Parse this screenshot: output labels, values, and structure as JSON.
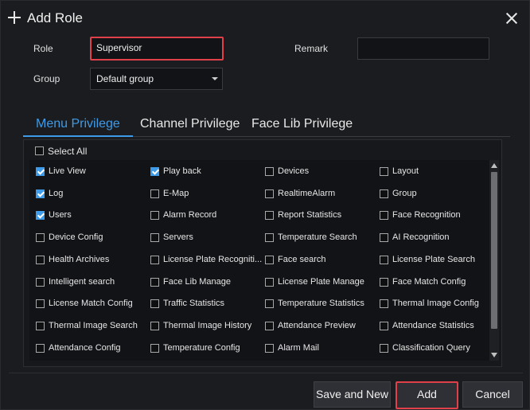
{
  "dialog": {
    "title": "Add Role"
  },
  "form": {
    "role_label": "Role",
    "role_value": "Supervisor",
    "remark_label": "Remark",
    "remark_value": "",
    "group_label": "Group",
    "group_value": "Default group"
  },
  "tabs": [
    "Menu Privilege",
    "Channel Privilege",
    "Face Lib Privilege"
  ],
  "active_tab": "Menu Privilege",
  "select_all": {
    "label": "Select All",
    "checked": false
  },
  "privileges": [
    {
      "label": "Live View",
      "checked": true
    },
    {
      "label": "Play back",
      "checked": true
    },
    {
      "label": "Devices",
      "checked": false
    },
    {
      "label": "Layout",
      "checked": false
    },
    {
      "label": "Log",
      "checked": true
    },
    {
      "label": "E-Map",
      "checked": false
    },
    {
      "label": "RealtimeAlarm",
      "checked": false
    },
    {
      "label": "Group",
      "checked": false
    },
    {
      "label": "Users",
      "checked": true
    },
    {
      "label": "Alarm Record",
      "checked": false
    },
    {
      "label": "Report Statistics",
      "checked": false
    },
    {
      "label": "Face Recognition",
      "checked": false
    },
    {
      "label": "Device Config",
      "checked": false
    },
    {
      "label": "Servers",
      "checked": false
    },
    {
      "label": "Temperature Search",
      "checked": false
    },
    {
      "label": "AI Recognition",
      "checked": false
    },
    {
      "label": "Health Archives",
      "checked": false
    },
    {
      "label": "License Plate Recogniti...",
      "checked": false
    },
    {
      "label": "Face search",
      "checked": false
    },
    {
      "label": "License Plate Search",
      "checked": false
    },
    {
      "label": "Intelligent search",
      "checked": false
    },
    {
      "label": "Face Lib Manage",
      "checked": false
    },
    {
      "label": "License Plate Manage",
      "checked": false
    },
    {
      "label": "Face Match Config",
      "checked": false
    },
    {
      "label": "License Match Config",
      "checked": false
    },
    {
      "label": "Traffic Statistics",
      "checked": false
    },
    {
      "label": "Temperature Statistics",
      "checked": false
    },
    {
      "label": "Thermal Image Config",
      "checked": false
    },
    {
      "label": "Thermal Image Search",
      "checked": false
    },
    {
      "label": "Thermal Image History",
      "checked": false
    },
    {
      "label": "Attendance Preview",
      "checked": false
    },
    {
      "label": "Attendance Statistics",
      "checked": false
    },
    {
      "label": "Attendance Config",
      "checked": false
    },
    {
      "label": "Temperature Config",
      "checked": false
    },
    {
      "label": "Alarm Mail",
      "checked": false
    },
    {
      "label": "Classification Query",
      "checked": false
    }
  ],
  "buttons": {
    "save_and_new": "Save and New",
    "add": "Add",
    "cancel": "Cancel"
  },
  "colors": {
    "accent": "#3d9be9",
    "highlight": "#e0404a",
    "background": "#1b1c1f"
  }
}
